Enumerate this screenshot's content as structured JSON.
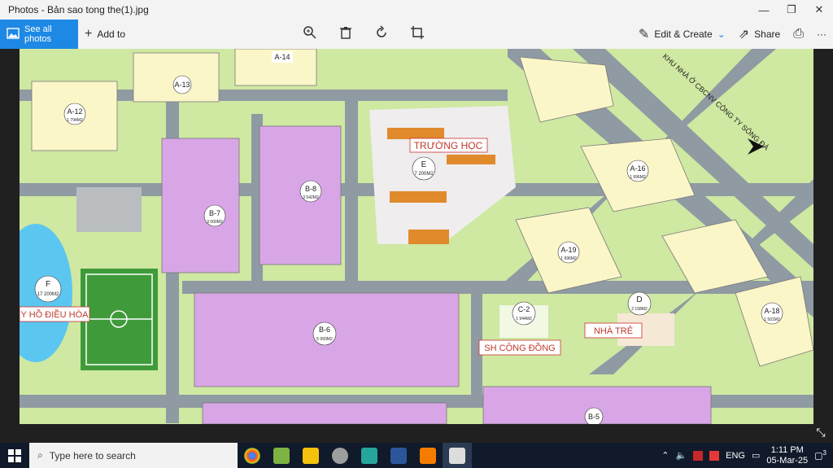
{
  "window": {
    "title": "Photos - Bản sao tong the(1).jpg",
    "minimize": "—",
    "maximize": "❐",
    "close": "✕"
  },
  "toolbar": {
    "see_all": "See all photos",
    "add_to": "Add to",
    "edit_create": "Edit & Create",
    "share": "Share",
    "more": "···"
  },
  "map": {
    "lots": {
      "a14": "A-14",
      "a13": "A-13",
      "a12": "A-12",
      "a12_area": "1 794M2",
      "b7": "B-7",
      "b7_area": "3 000M2",
      "b8": "B-8",
      "b8_area": "3 542M2",
      "e": "E",
      "e_area": "7 200M2",
      "a16": "A-16",
      "a16_area": "1 996M2",
      "a19": "A-19",
      "a19_area": "1 996M2",
      "a18": "A-18",
      "a18_area": "1 501M2",
      "f": "F",
      "f_area": "17 200M2",
      "b6": "B-6",
      "b6_area": "5 993M2",
      "c2": "C-2",
      "c2_area": "1 944M2",
      "d": "D",
      "d_area": "2 158M2",
      "b5": "B-5"
    },
    "labels": {
      "school": "TRƯỜNG HỌC",
      "lake": "Y HỒ ĐIỀU HÒA",
      "community": "SH CỘNG ĐỒNG",
      "nursery": "NHÀ TRẺ",
      "road_text": "KHU NHÀ Ở CBCNV CÔNG TY SÔNG ĐÀ"
    },
    "colors": {
      "green": "#9ccc65",
      "road": "#8f9aa3",
      "yellow_lot": "#fbf6c8",
      "pink_lot": "#d8a6e6",
      "school_roof": "#e08a2c",
      "lake": "#5bc6f0"
    }
  },
  "taskbar": {
    "search_placeholder": "Type here to search",
    "time": "1:11 PM",
    "date": "05-Mar-25",
    "lang": "ENG",
    "notif_count": "3"
  }
}
